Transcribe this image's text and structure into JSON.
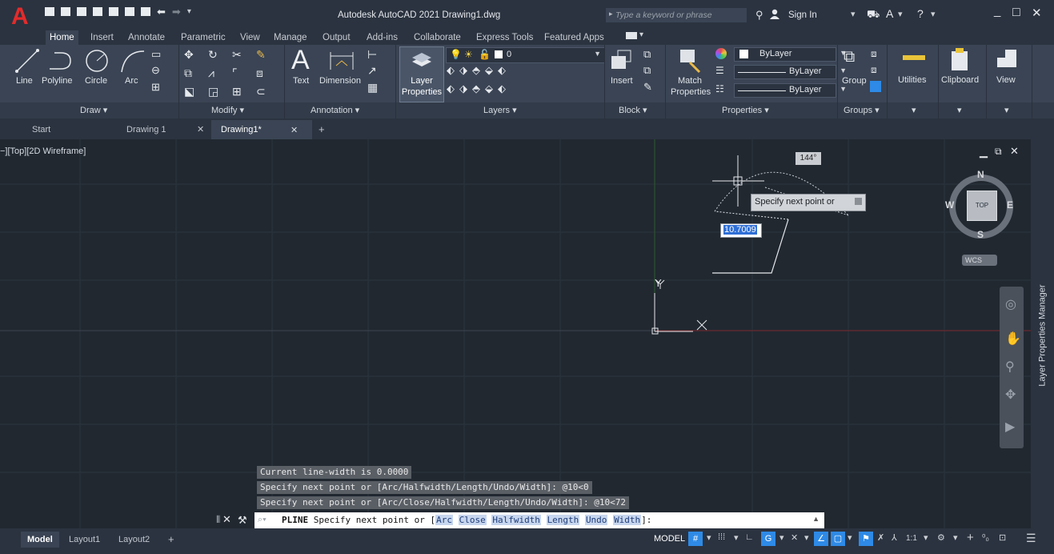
{
  "app": {
    "title": "Autodesk AutoCAD 2021  Drawing1.dwg",
    "logo": "A",
    "search_placeholder": "Type a keyword or phrase",
    "sign_in": "Sign In",
    "window_controls": {
      "minimize": "_",
      "maximize": "□",
      "close": "✕"
    }
  },
  "ribbon_tabs": [
    "Home",
    "Insert",
    "Annotate",
    "Parametric",
    "View",
    "Manage",
    "Output",
    "Add-ins",
    "Collaborate",
    "Express Tools",
    "Featured Apps"
  ],
  "ribbon": {
    "draw": {
      "line": "Line",
      "polyline": "Polyline",
      "circle": "Circle",
      "arc": "Arc",
      "panel": "Draw ▾"
    },
    "modify": {
      "panel": "Modify ▾"
    },
    "annotation": {
      "text": "Text",
      "dimension": "Dimension",
      "panel": "Annotation ▾"
    },
    "layers": {
      "layer_properties_1": "Layer",
      "layer_properties_2": "Properties",
      "current_layer": "0",
      "panel": "Layers ▾"
    },
    "block": {
      "insert": "Insert",
      "panel": "Block ▾"
    },
    "properties": {
      "match_1": "Match",
      "match_2": "Properties",
      "color": "ByLayer",
      "linetype": "ByLayer",
      "lineweight": "ByLayer",
      "panel": "Properties ▾"
    },
    "groups": {
      "group": "Group",
      "panel": "Groups ▾"
    },
    "utilities": {
      "label": "Utilities",
      "panel": "▾"
    },
    "clipboard": {
      "label": "Clipboard",
      "panel": "▾"
    },
    "view": {
      "label": "View",
      "panel": "▾"
    }
  },
  "doc_tabs": {
    "start": "Start",
    "drawing_1": "Drawing 1",
    "drawing1_active": "Drawing1*",
    "close": "✕",
    "add": "+"
  },
  "viewport": {
    "label": "−][Top][2D Wireframe]",
    "angle": "144°",
    "prompt": "Specify next point or",
    "length_input": "10.7009",
    "y_axis": "Y",
    "x_axis": "X"
  },
  "viewcube": {
    "n": "N",
    "s": "S",
    "e": "E",
    "w": "W",
    "top": "TOP",
    "wcs": "WCS"
  },
  "side_palette": "Layer Properties Manager",
  "command_history": [
    "Current line-width is 0.0000",
    "Specify next point or [Arc/Halfwidth/Length/Undo/Width]: @10<0",
    "Specify next point or [Arc/Close/Halfwidth/Length/Undo/Width]: @10<72"
  ],
  "command_line": {
    "command": "PLINE",
    "prompt": "Specify next point or [",
    "options": [
      "Arc",
      "Close",
      "Halfwidth",
      "Length",
      "Undo",
      "Width"
    ],
    "end": "]:"
  },
  "layout_tabs": [
    "Model",
    "Layout1",
    "Layout2",
    "+"
  ],
  "status": {
    "model": "MODEL",
    "scale": "1:1"
  },
  "colors": {
    "accent": "#2e8ae6",
    "canvas": "#212830",
    "ribbon": "#3a4454",
    "title": "#2b3340",
    "logo": "#e32b2b"
  }
}
